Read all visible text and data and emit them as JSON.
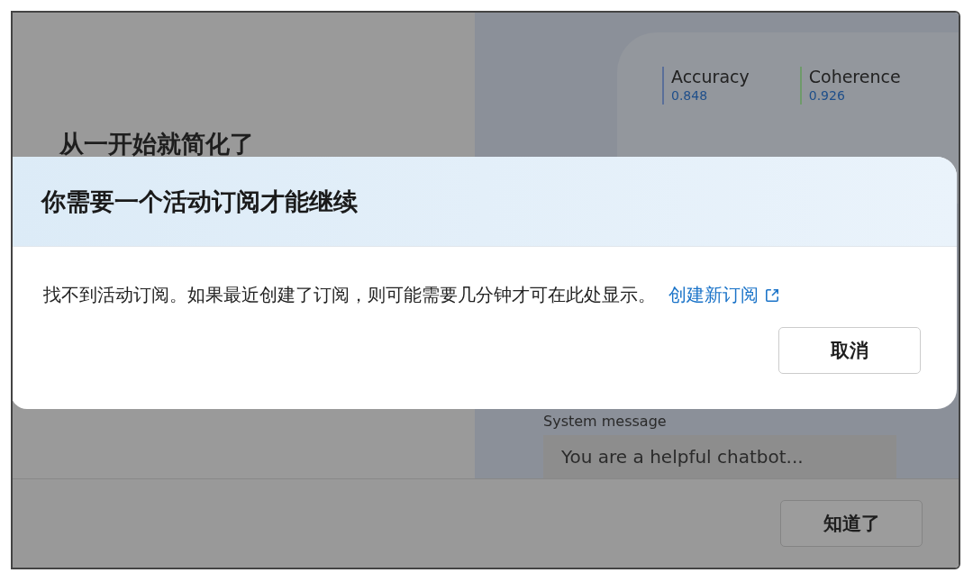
{
  "background": {
    "heading": "从一开始就简化了",
    "metrics": [
      {
        "name": "Accuracy",
        "value": "0.848",
        "color": "#5a6f99"
      },
      {
        "name": "Coherence",
        "value": "0.926",
        "color": "#6f9a6a"
      }
    ],
    "system_message": {
      "label": "System message",
      "value": "You are a helpful chatbot..."
    },
    "footer_button": "知道了"
  },
  "dialog": {
    "title": "你需要一个活动订阅才能继续",
    "message": "找不到活动订阅。如果最近创建了订阅，则可能需要几分钟才可在此处显示。",
    "link": "创建新订阅",
    "buttons": [
      "取消"
    ]
  }
}
